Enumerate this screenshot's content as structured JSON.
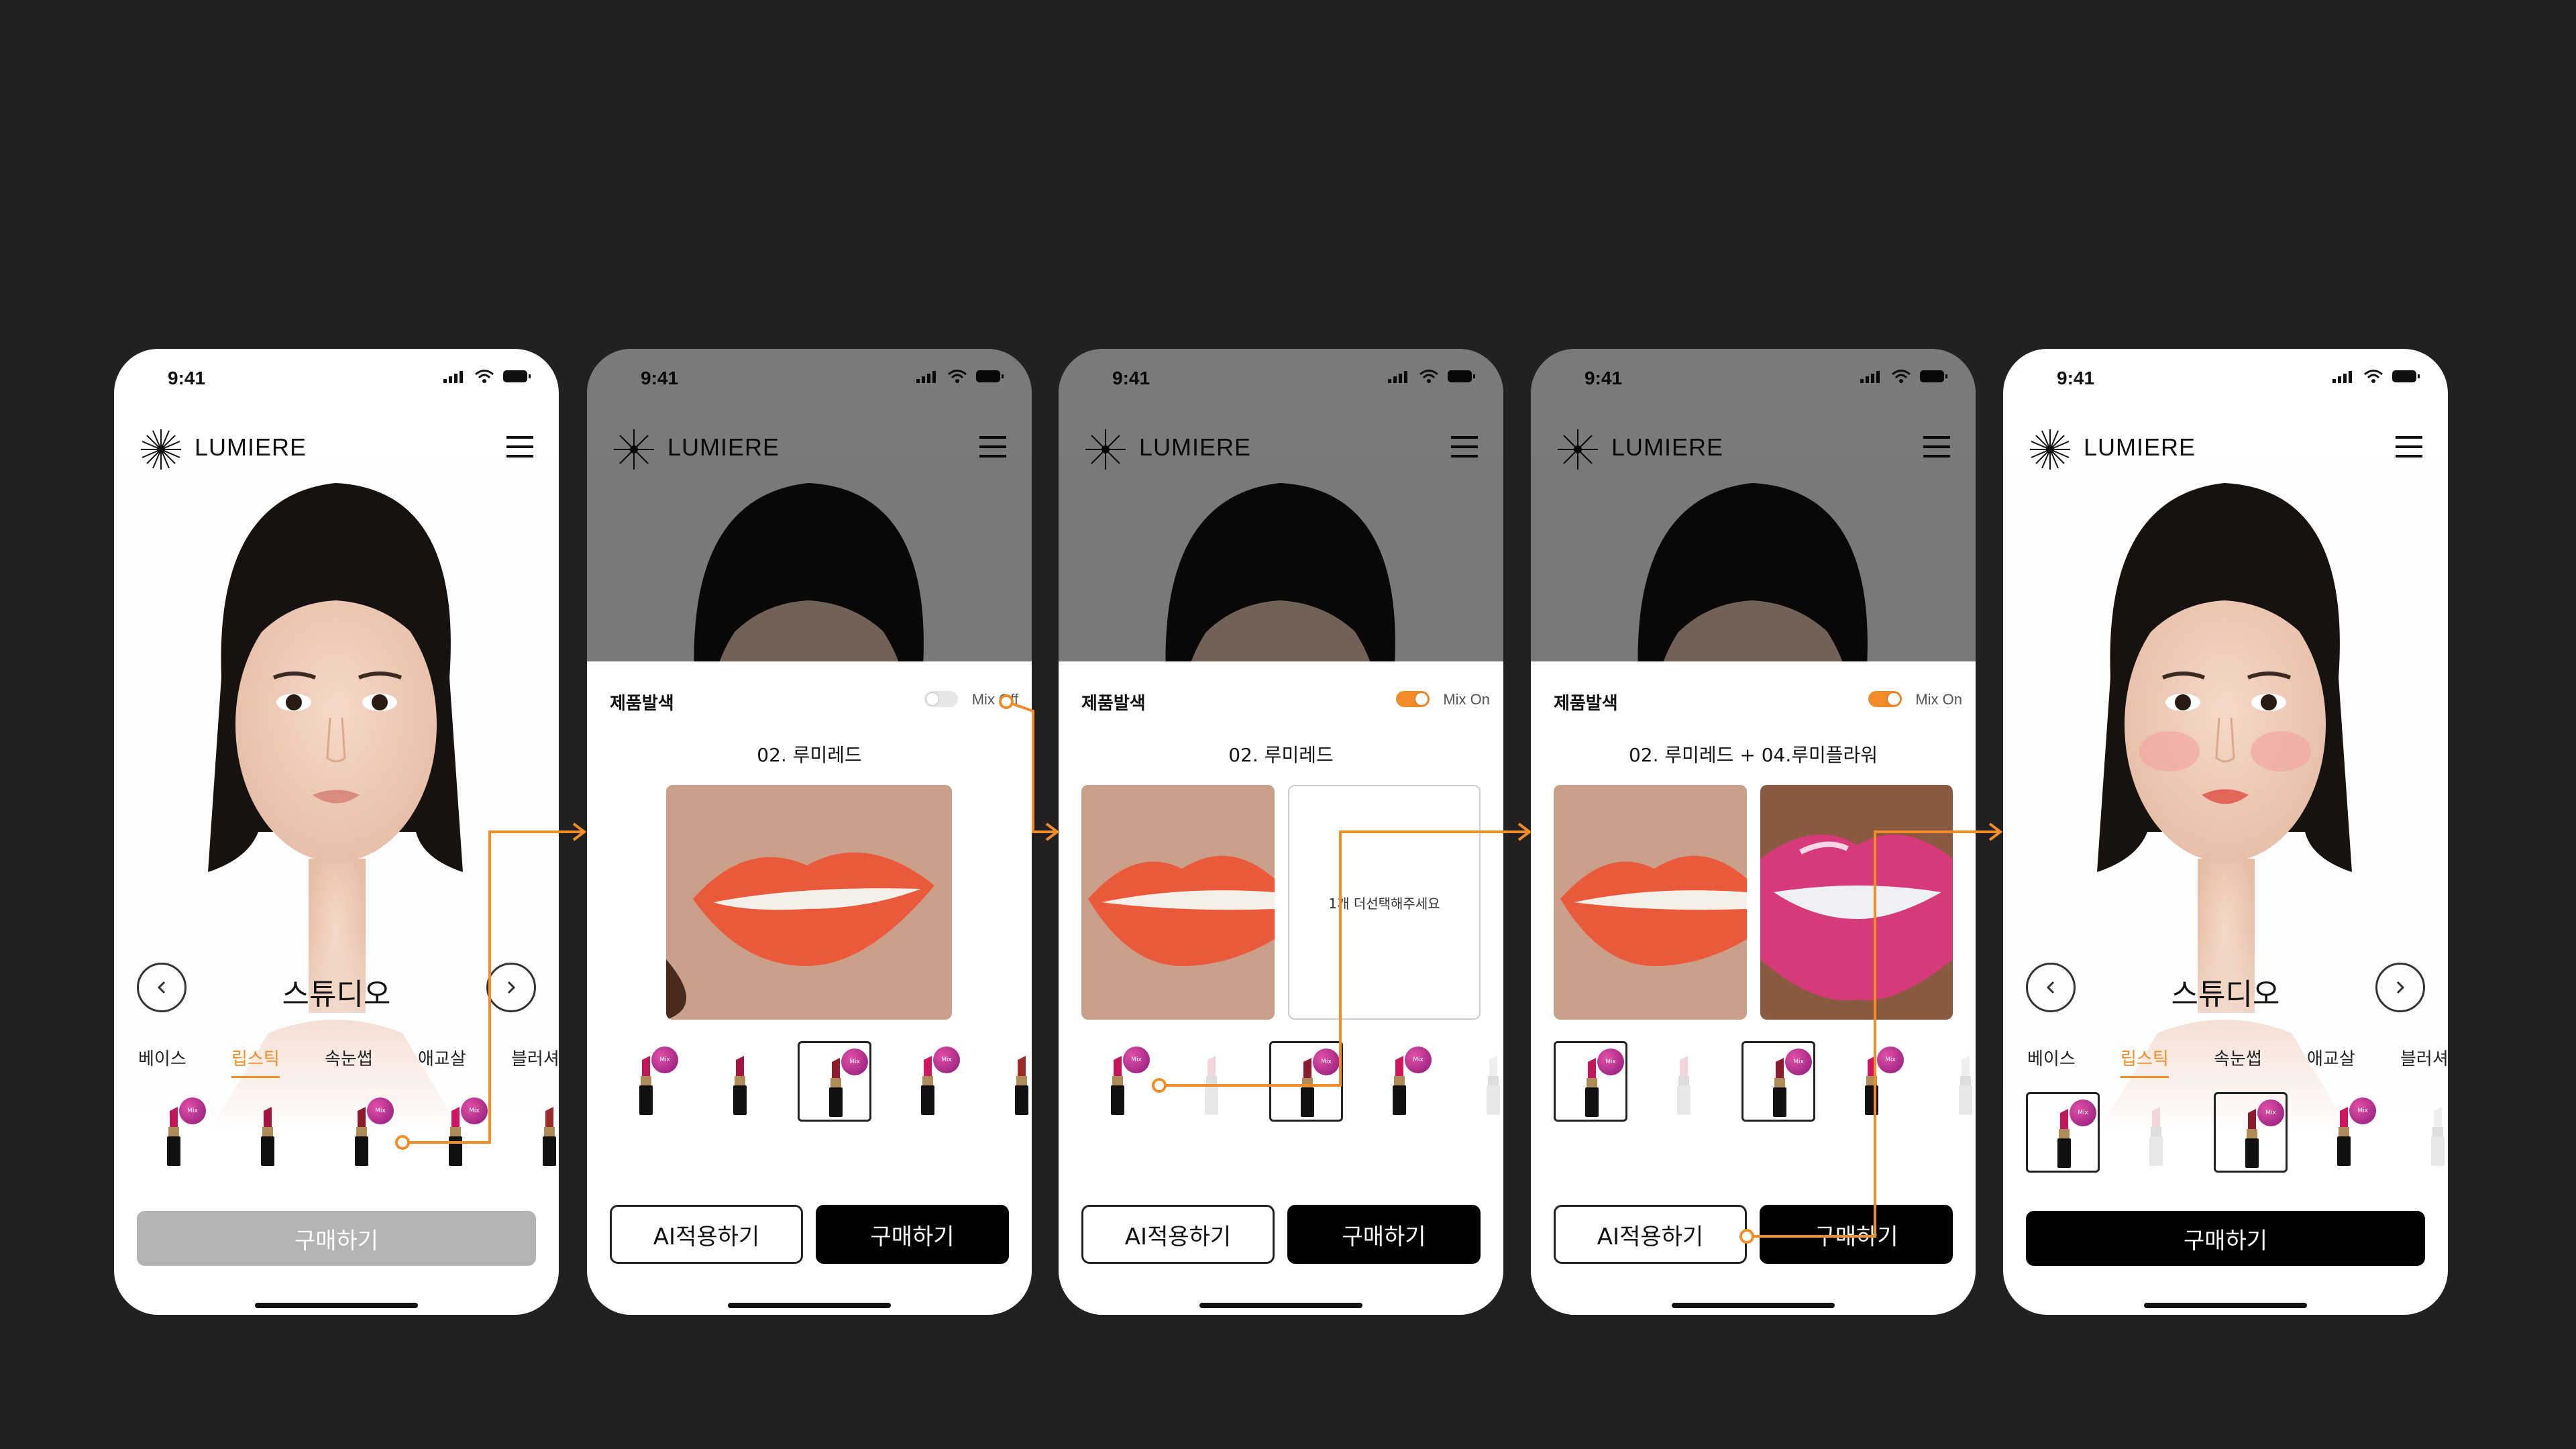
{
  "status": {
    "time": "9:41"
  },
  "app": {
    "brand": "LUMIERE",
    "studio_title": "스튜디오"
  },
  "tabs": [
    "베이스",
    "립스틱",
    "속눈썹",
    "애교살",
    "블러셔"
  ],
  "active_tab": "립스틱",
  "mix_badge": "Mix",
  "buttons": {
    "buy": "구매하기",
    "ai_apply": "AI적용하기"
  },
  "sheet": {
    "title": "제품발색",
    "mix_off_label": "Mix Off",
    "mix_on_label": "Mix On",
    "product_single": "02. 루미레드",
    "product_combo": "02. 루미레드 + 04.루미플라워",
    "select_prompt": "1개 더선택해주세요"
  },
  "screens": [
    {
      "id": "home",
      "buy_enabled": false,
      "selected": []
    },
    {
      "id": "sheet-mix-off",
      "mix": false,
      "selected": [
        2
      ]
    },
    {
      "id": "sheet-mix-on",
      "mix": true,
      "selected": [
        2
      ]
    },
    {
      "id": "sheet-mix-combo",
      "mix": true,
      "selected": [
        0,
        2
      ]
    },
    {
      "id": "home-applied",
      "buy_enabled": true,
      "selected": [
        0,
        2
      ]
    }
  ],
  "colors": {
    "accent": "#f28c28",
    "background": "#212121",
    "lip_coral": "#ea5a3a",
    "lip_pink": "#d63a7a"
  }
}
